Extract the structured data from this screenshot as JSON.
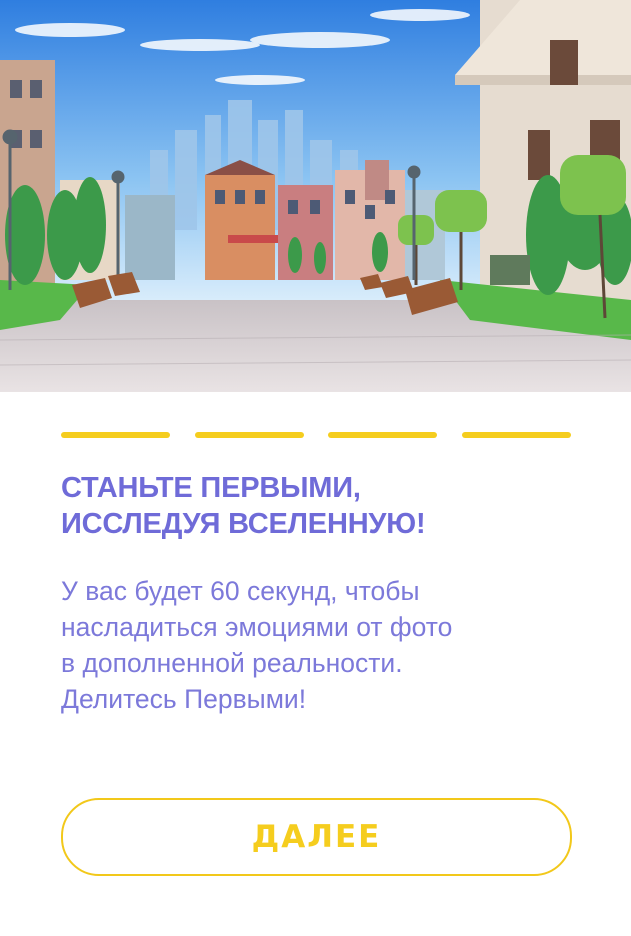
{
  "colors": {
    "accent_yellow": "#f5cd1e",
    "title_purple": "#6f6bd8",
    "text_purple": "#7c79da",
    "button_border": "#f2c81a"
  },
  "hero": {
    "image": "cartoon-city-square-illustration"
  },
  "progress": {
    "total_steps": 4,
    "active_steps": 4
  },
  "title": {
    "line1": "СТАНЬТЕ ПЕРВЫМИ,",
    "line2": "ИССЛЕДУЯ ВСЕЛЕННУЮ!"
  },
  "description": {
    "line1": "У вас будет 60 секунд, чтобы",
    "line2": "насладиться эмоциями от фото",
    "line3": "в дополненной реальности.",
    "line4": "Делитесь Первыми!"
  },
  "button": {
    "label": "ДАЛЕЕ"
  }
}
